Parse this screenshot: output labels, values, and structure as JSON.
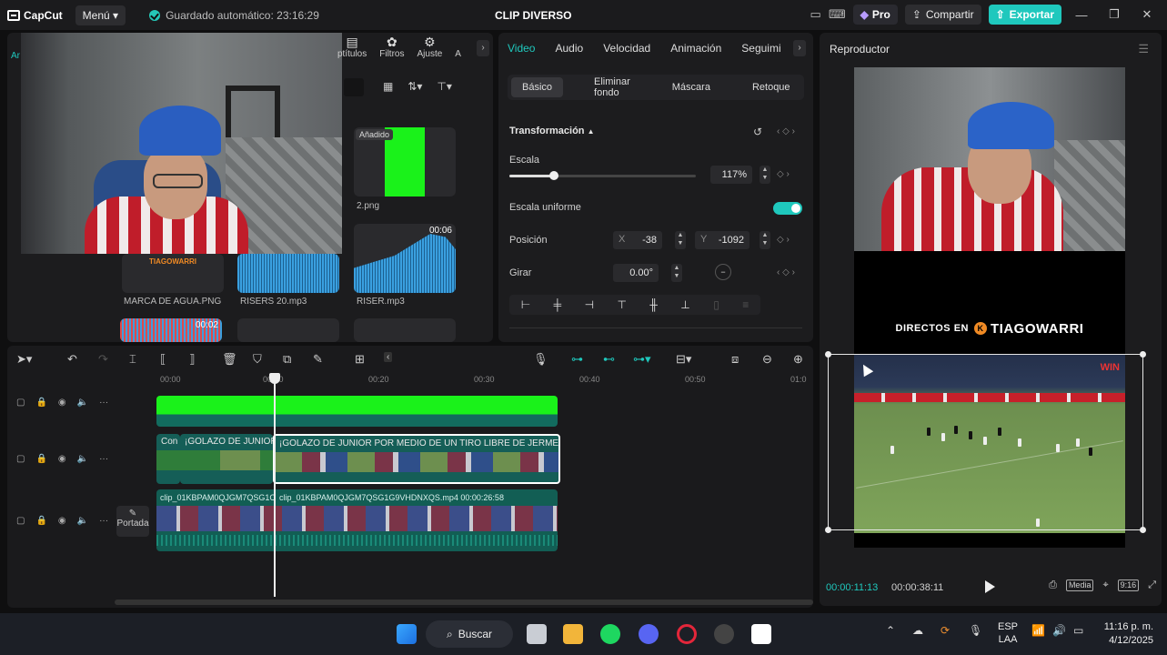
{
  "titlebar": {
    "app_name": "CapCut",
    "menu_label": "Menú",
    "autosave_text": "Guardado automático: 23:16:29",
    "project_title": "CLIP DIVERSO",
    "pro_label": "Pro",
    "share_label": "Compartir",
    "export_label": "Exportar"
  },
  "media": {
    "left_tab_letter": "Ar",
    "tabs": [
      {
        "label": "ptítulos",
        "icon": "subtitle-icon"
      },
      {
        "label": "Filtros",
        "icon": "filter-icon"
      },
      {
        "label": "Ajuste",
        "icon": "adjust-icon"
      },
      {
        "label": "A",
        "icon": "more-icon"
      }
    ],
    "items": [
      {
        "name": "2.png",
        "badge": "Añadido"
      },
      {
        "name": "RISER.mp3",
        "duration": "00:06"
      },
      {
        "name": "MARCA DE AGUA.PNG",
        "overlay": "TIAGOWARRI"
      },
      {
        "name": "RISERS 20.mp3"
      },
      {
        "name": "",
        "duration": "00:02"
      }
    ]
  },
  "properties": {
    "tabs": [
      "Video",
      "Audio",
      "Velocidad",
      "Animación",
      "Seguimi"
    ],
    "active_tab": "Video",
    "subtabs": [
      "Básico",
      "Eliminar fondo",
      "Máscara",
      "Retoque"
    ],
    "active_subtab": "Básico",
    "section_title": "Transformación",
    "scale_label": "Escala",
    "scale_value": "117%",
    "uniform_scale_label": "Escala uniforme",
    "uniform_scale_on": true,
    "position_label": "Posición",
    "pos_x_label": "X",
    "pos_x_value": "-38",
    "pos_y_label": "Y",
    "pos_y_value": "-1092",
    "rotate_label": "Girar",
    "rotate_value": "0.00°"
  },
  "player": {
    "title": "Reproductor",
    "banner_text": "DIRECTOS EN",
    "banner_brand": "TIAGOWARRI",
    "current_time": "00:00:11:13",
    "total_time": "00:00:38:11",
    "media_label": "Media",
    "ratio_label": "9:16",
    "scoreboard_logo": "WIN"
  },
  "timeline": {
    "ruler": [
      "00:00",
      "00:10",
      "00:20",
      "00:30",
      "00:40",
      "00:50",
      "01:0"
    ],
    "clips": {
      "video_a_caption": "Con",
      "video_b_caption": "¡GOLAZO DE JUNIOR",
      "video_c_caption": "¡GOLAZO DE JUNIOR POR MEDIO DE UN TIRO LIBRE DE JERMEIN PEÑ",
      "main_a_caption": "clip_01KBPAM0QJGM7QSG1C",
      "main_b_caption": "clip_01KBPAM0QJGM7QSG1G9VHDNXQS.mp4  00:00:26:58"
    },
    "cover_label": "Portada"
  },
  "taskbar": {
    "search_label": "Buscar",
    "lang_top": "ESP",
    "lang_bottom": "LAA",
    "time": "11:16 p. m.",
    "date": "4/12/2025"
  },
  "colors": {
    "accent": "#1fc8bd",
    "green_screen": "#1af21a"
  }
}
